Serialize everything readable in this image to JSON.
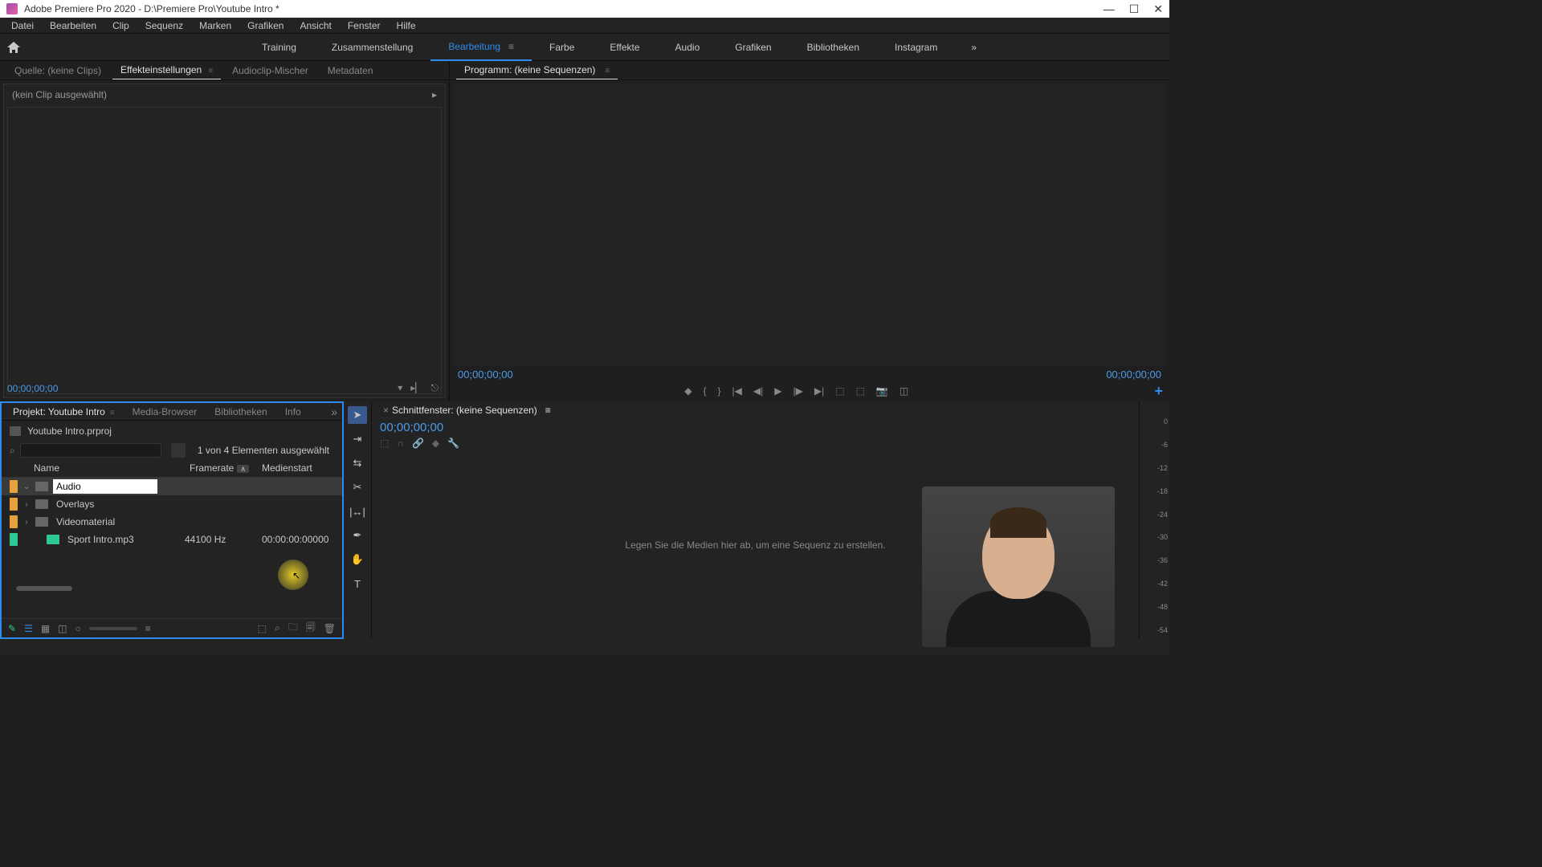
{
  "title": "Adobe Premiere Pro 2020 - D:\\Premiere Pro\\Youtube Intro *",
  "menu": [
    "Datei",
    "Bearbeiten",
    "Clip",
    "Sequenz",
    "Marken",
    "Grafiken",
    "Ansicht",
    "Fenster",
    "Hilfe"
  ],
  "workspaces": {
    "items": [
      "Training",
      "Zusammenstellung",
      "Bearbeitung",
      "Farbe",
      "Effekte",
      "Audio",
      "Grafiken",
      "Bibliotheken",
      "Instagram"
    ],
    "active": "Bearbeitung"
  },
  "source": {
    "tabs": [
      "Quelle: (keine Clips)",
      "Effekteinstellungen",
      "Audioclip-Mischer",
      "Metadaten"
    ],
    "active": "Effekteinstellungen",
    "clip_label": "(kein Clip ausgewählt)",
    "timecode": "00;00;00;00"
  },
  "program": {
    "title": "Programm: (keine Sequenzen)",
    "timecode_left": "00;00;00;00",
    "timecode_right": "00;00;00;00"
  },
  "project": {
    "tabs": [
      "Projekt: Youtube Intro",
      "Media-Browser",
      "Bibliotheken",
      "Info"
    ],
    "active": "Projekt: Youtube Intro",
    "file": "Youtube Intro.prproj",
    "selection_count": "1 von 4 Elementen ausgewählt",
    "columns": {
      "name": "Name",
      "framerate": "Framerate",
      "medienstart": "Medienstart"
    },
    "rows": [
      {
        "tag": "orange",
        "type": "folder",
        "name": "Audio",
        "expanded": true,
        "editing": true,
        "selected": true
      },
      {
        "tag": "orange",
        "type": "folder",
        "name": "Overlays",
        "expanded": false
      },
      {
        "tag": "orange",
        "type": "folder",
        "name": "Videomaterial",
        "expanded": false
      },
      {
        "tag": "green",
        "type": "audio",
        "name": "Sport Intro.mp3",
        "framerate": "44100  Hz",
        "medienstart": "00:00:00:00000"
      }
    ]
  },
  "timeline": {
    "title": "Schnittfenster: (keine Sequenzen)",
    "timecode": "00;00;00;00",
    "drop_hint": "Legen Sie die Medien hier ab, um eine Sequenz zu erstellen."
  },
  "audio_meter": [
    "0",
    "-6",
    "-12",
    "-18",
    "-24",
    "-30",
    "-36",
    "-42",
    "-48",
    "-54"
  ],
  "tools": [
    "selection",
    "track-select",
    "ripple",
    "razor",
    "slip",
    "pen",
    "hand",
    "type"
  ]
}
